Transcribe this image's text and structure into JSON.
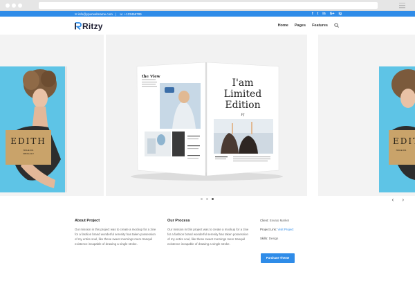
{
  "topbar": {
    "email": "info@ypurwebname.com",
    "phone": "+123456789",
    "social": [
      "f",
      "t",
      "in",
      "G+",
      "ig"
    ]
  },
  "nav": {
    "logo": "Ritzy",
    "menu": [
      "Home",
      "Pages",
      "Features"
    ]
  },
  "slides": {
    "left_cover_title": "EDITH",
    "left_cover_sub1": "ISSUE 001",
    "left_cover_sub2": "SPRING 2017",
    "magazine_left_title": "the View",
    "magazine_right_title_1": "I'am",
    "magazine_right_title_2": "Limited",
    "magazine_right_title_3": "Edition",
    "magazine_right_sig": "Pj",
    "right_cover_title": "EDITH",
    "right_cover_sub1": "ISSUE 001"
  },
  "carousel": {
    "active_index": 2,
    "count": 3
  },
  "about": {
    "heading": "About Project",
    "text": "Our mission in this project was to create a mockup for a zine for a fashion brand wonderful serenity has taken possession of my entire soul, like these sweet mornings mere tranquil existence incapable of drawing a single stroke."
  },
  "process": {
    "heading": "Our Process",
    "text": "Our mission in this project was to create a mockup for a zine for a fashion brand wonderful serenity has taken possession of my entire soul, like these sweet mornings mere tranquil existence incapable of drawing a single stroke."
  },
  "meta": {
    "client_label": "Client:",
    "client_value": "Envato Market",
    "link_label": "Project Link:",
    "link_value": "Visit Project",
    "skills_label": "Skills:",
    "skills_value": "Design"
  },
  "button_label": "Purchase Theme",
  "colors": {
    "accent": "#2f8ce8",
    "cover_bg": "#5ec4e6",
    "gold": "#c9a36a"
  }
}
